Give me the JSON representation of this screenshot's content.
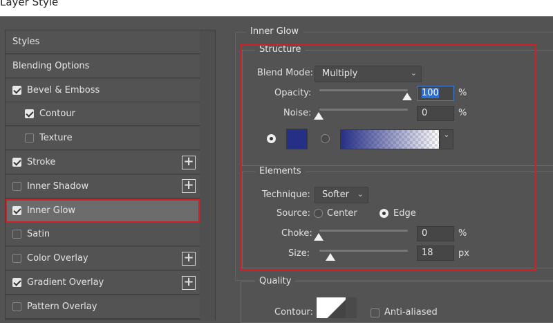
{
  "window": {
    "title": "Layer Style"
  },
  "sidebar": {
    "items": [
      {
        "label": "Styles",
        "checkbox": null,
        "plus": false,
        "selected": false
      },
      {
        "label": "Blending Options",
        "checkbox": null,
        "plus": false,
        "selected": false
      },
      {
        "label": "Bevel & Emboss",
        "checkbox": true,
        "plus": false,
        "selected": false
      },
      {
        "label": "Contour",
        "checkbox": true,
        "plus": false,
        "selected": false,
        "indent": true
      },
      {
        "label": "Texture",
        "checkbox": false,
        "plus": false,
        "selected": false,
        "indent": true
      },
      {
        "label": "Stroke",
        "checkbox": true,
        "plus": true,
        "selected": false
      },
      {
        "label": "Inner Shadow",
        "checkbox": false,
        "plus": true,
        "selected": false
      },
      {
        "label": "Inner Glow",
        "checkbox": true,
        "plus": false,
        "selected": true
      },
      {
        "label": "Satin",
        "checkbox": false,
        "plus": false,
        "selected": false
      },
      {
        "label": "Color Overlay",
        "checkbox": false,
        "plus": true,
        "selected": false
      },
      {
        "label": "Gradient Overlay",
        "checkbox": true,
        "plus": true,
        "selected": false
      },
      {
        "label": "Pattern Overlay",
        "checkbox": false,
        "plus": false,
        "selected": false
      }
    ]
  },
  "panel": {
    "title": "Inner Glow",
    "structure": {
      "title": "Structure",
      "blend_mode_label": "Blend Mode:",
      "blend_mode": "Multiply",
      "opacity_label": "Opacity:",
      "opacity": "100",
      "opacity_unit": "%",
      "opacity_pct": 100,
      "noise_label": "Noise:",
      "noise": "0",
      "noise_unit": "%",
      "noise_pct": 0,
      "color": "#262f86"
    },
    "elements": {
      "title": "Elements",
      "technique_label": "Technique:",
      "technique": "Softer",
      "source_label": "Source:",
      "source_center": "Center",
      "source_edge": "Edge",
      "choke_label": "Choke:",
      "choke": "0",
      "choke_unit": "%",
      "choke_pct": 0,
      "size_label": "Size:",
      "size": "18",
      "size_unit": "px",
      "size_pct": 7
    },
    "quality": {
      "title": "Quality",
      "contour_label": "Contour:",
      "anti_aliased": "Anti-aliased"
    }
  },
  "colors": {
    "highlight": "#d32027"
  }
}
